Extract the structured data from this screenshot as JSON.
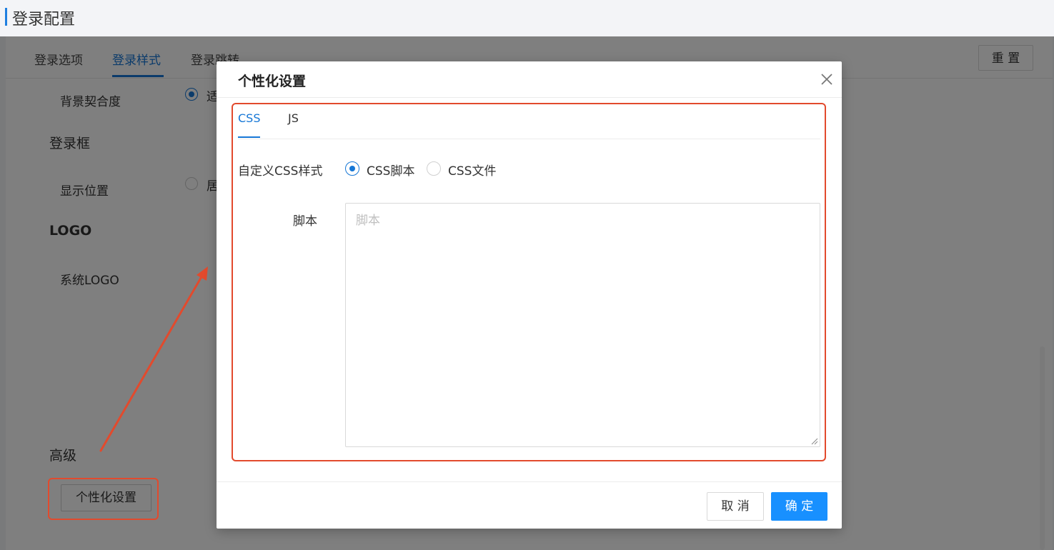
{
  "page": {
    "title": "登录配置"
  },
  "tabs": [
    {
      "label": "登录选项"
    },
    {
      "label": "登录样式"
    },
    {
      "label": "登录跳转"
    }
  ],
  "toolbar": {
    "reset_label": "重 置"
  },
  "background_form": {
    "bg_fit_label": "背景契合度",
    "bg_fit_option": "适",
    "login_box_section": "登录框",
    "display_position_label": "显示位置",
    "display_position_option": "居",
    "logo_section": "LOGO",
    "system_logo_label": "系统LOGO",
    "advanced_section": "高级",
    "personalize_button": "个性化设置"
  },
  "dialog": {
    "title": "个性化设置",
    "tabs": [
      {
        "label": "CSS"
      },
      {
        "label": "JS"
      }
    ],
    "custom_css_label": "自定义CSS样式",
    "radio_options": [
      {
        "label": "CSS脚本",
        "checked": true
      },
      {
        "label": "CSS文件",
        "checked": false
      }
    ],
    "script_label": "脚本",
    "script_value": "",
    "script_placeholder": "脚本",
    "cancel_label": "取 消",
    "ok_label": "确 定"
  },
  "colors": {
    "accent": "#1677d6",
    "primary_button": "#1890ff",
    "highlight": "#e24a2d"
  }
}
